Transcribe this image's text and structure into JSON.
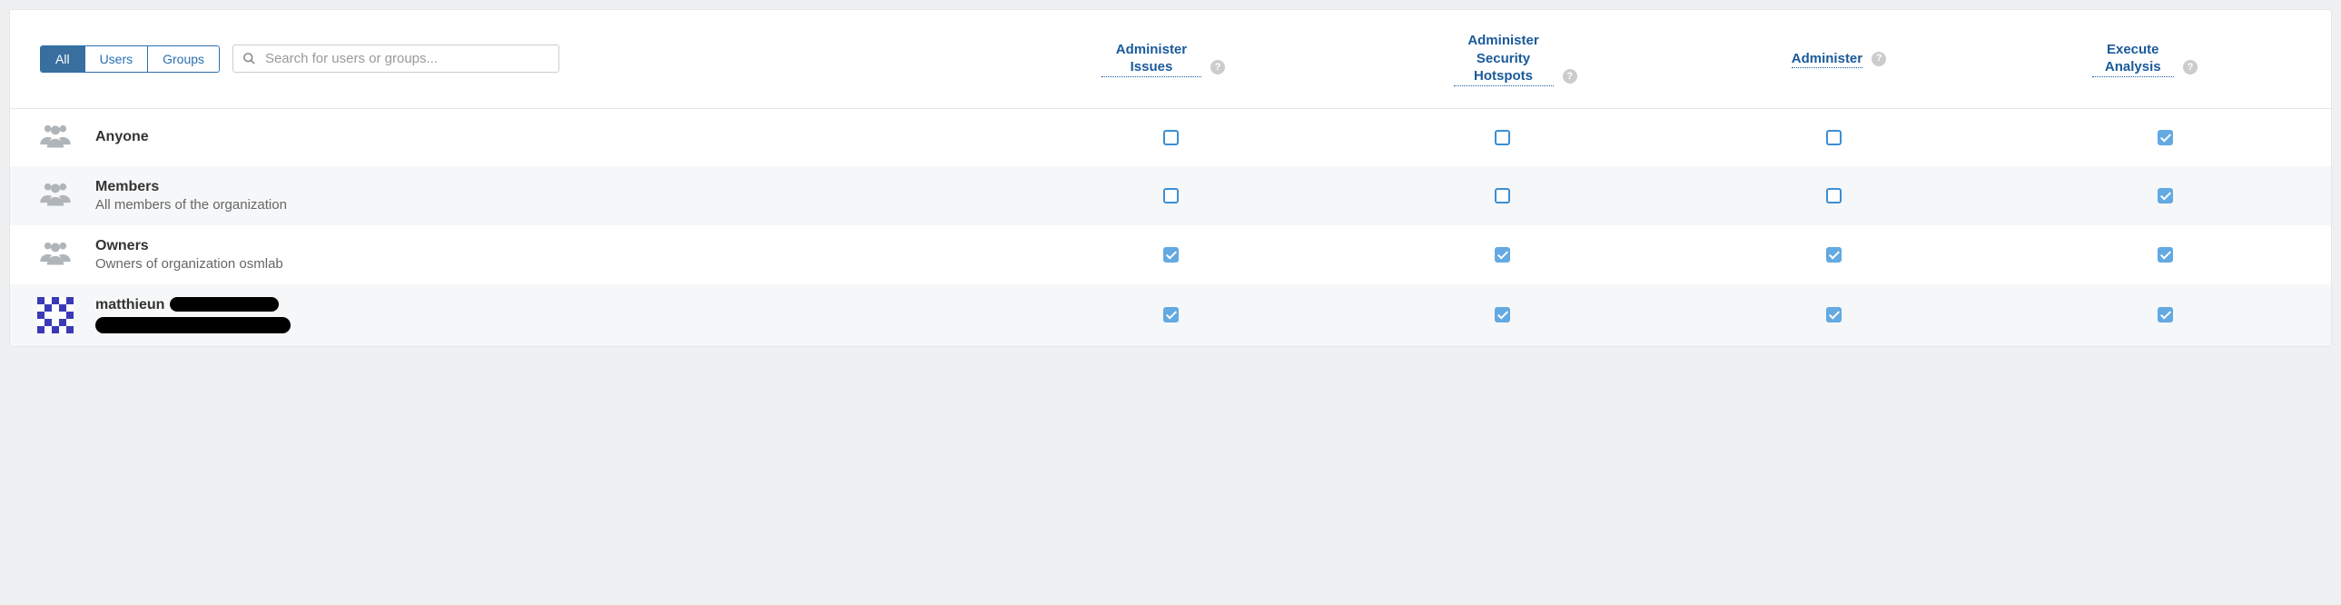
{
  "filters": {
    "all": "All",
    "users": "Users",
    "groups": "Groups",
    "active": "all"
  },
  "search": {
    "placeholder": "Search for users or groups..."
  },
  "columns": [
    {
      "label": "Administer Issues"
    },
    {
      "label": "Administer Security Hotspots"
    },
    {
      "label": "Administer"
    },
    {
      "label": "Execute Analysis"
    }
  ],
  "rows": [
    {
      "type": "group",
      "name": "Anyone",
      "desc": "",
      "perms": [
        false,
        false,
        false,
        true
      ]
    },
    {
      "type": "group",
      "name": "Members",
      "desc": "All members of the organization",
      "perms": [
        false,
        false,
        false,
        true
      ]
    },
    {
      "type": "group",
      "name": "Owners",
      "desc": "Owners of organization osmlab",
      "perms": [
        true,
        true,
        true,
        true
      ]
    },
    {
      "type": "user",
      "name": "matthieun",
      "redacted": true,
      "perms": [
        true,
        true,
        true,
        true
      ]
    }
  ]
}
